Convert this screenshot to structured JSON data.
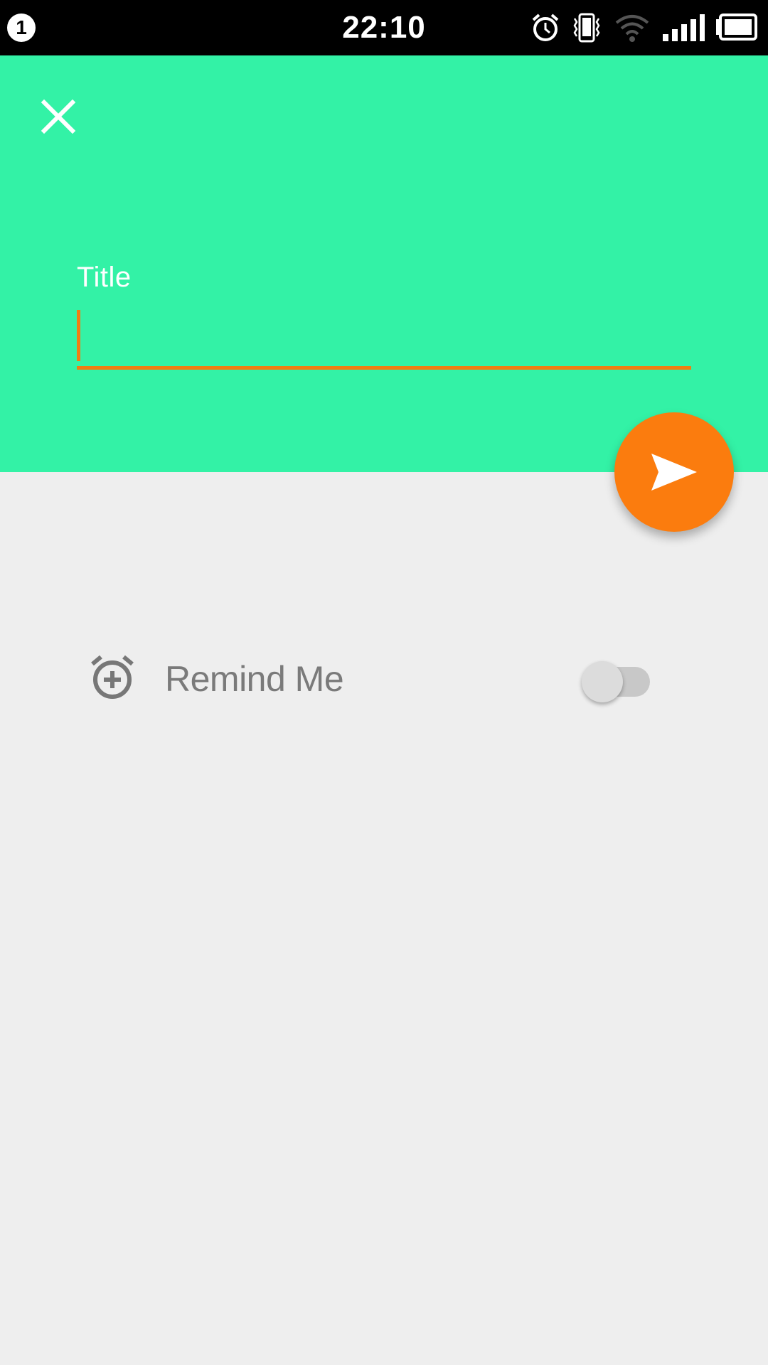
{
  "status_bar": {
    "notification_count": "1",
    "time": "22:10",
    "icons": [
      "alarm-icon",
      "vibrate-icon",
      "wifi-icon",
      "signal-icon",
      "battery-icon"
    ]
  },
  "header": {
    "close_icon": "close-icon",
    "title_label": "Title",
    "title_value": "",
    "title_placeholder": ""
  },
  "fab": {
    "icon": "send-icon"
  },
  "remind": {
    "icon": "alarm-add-icon",
    "label": "Remind Me",
    "enabled": false
  },
  "colors": {
    "accent": "#fb7c0e",
    "header_bg": "#33f2a6",
    "page_bg": "#eeeeee",
    "text_muted": "#7a7a7a"
  }
}
